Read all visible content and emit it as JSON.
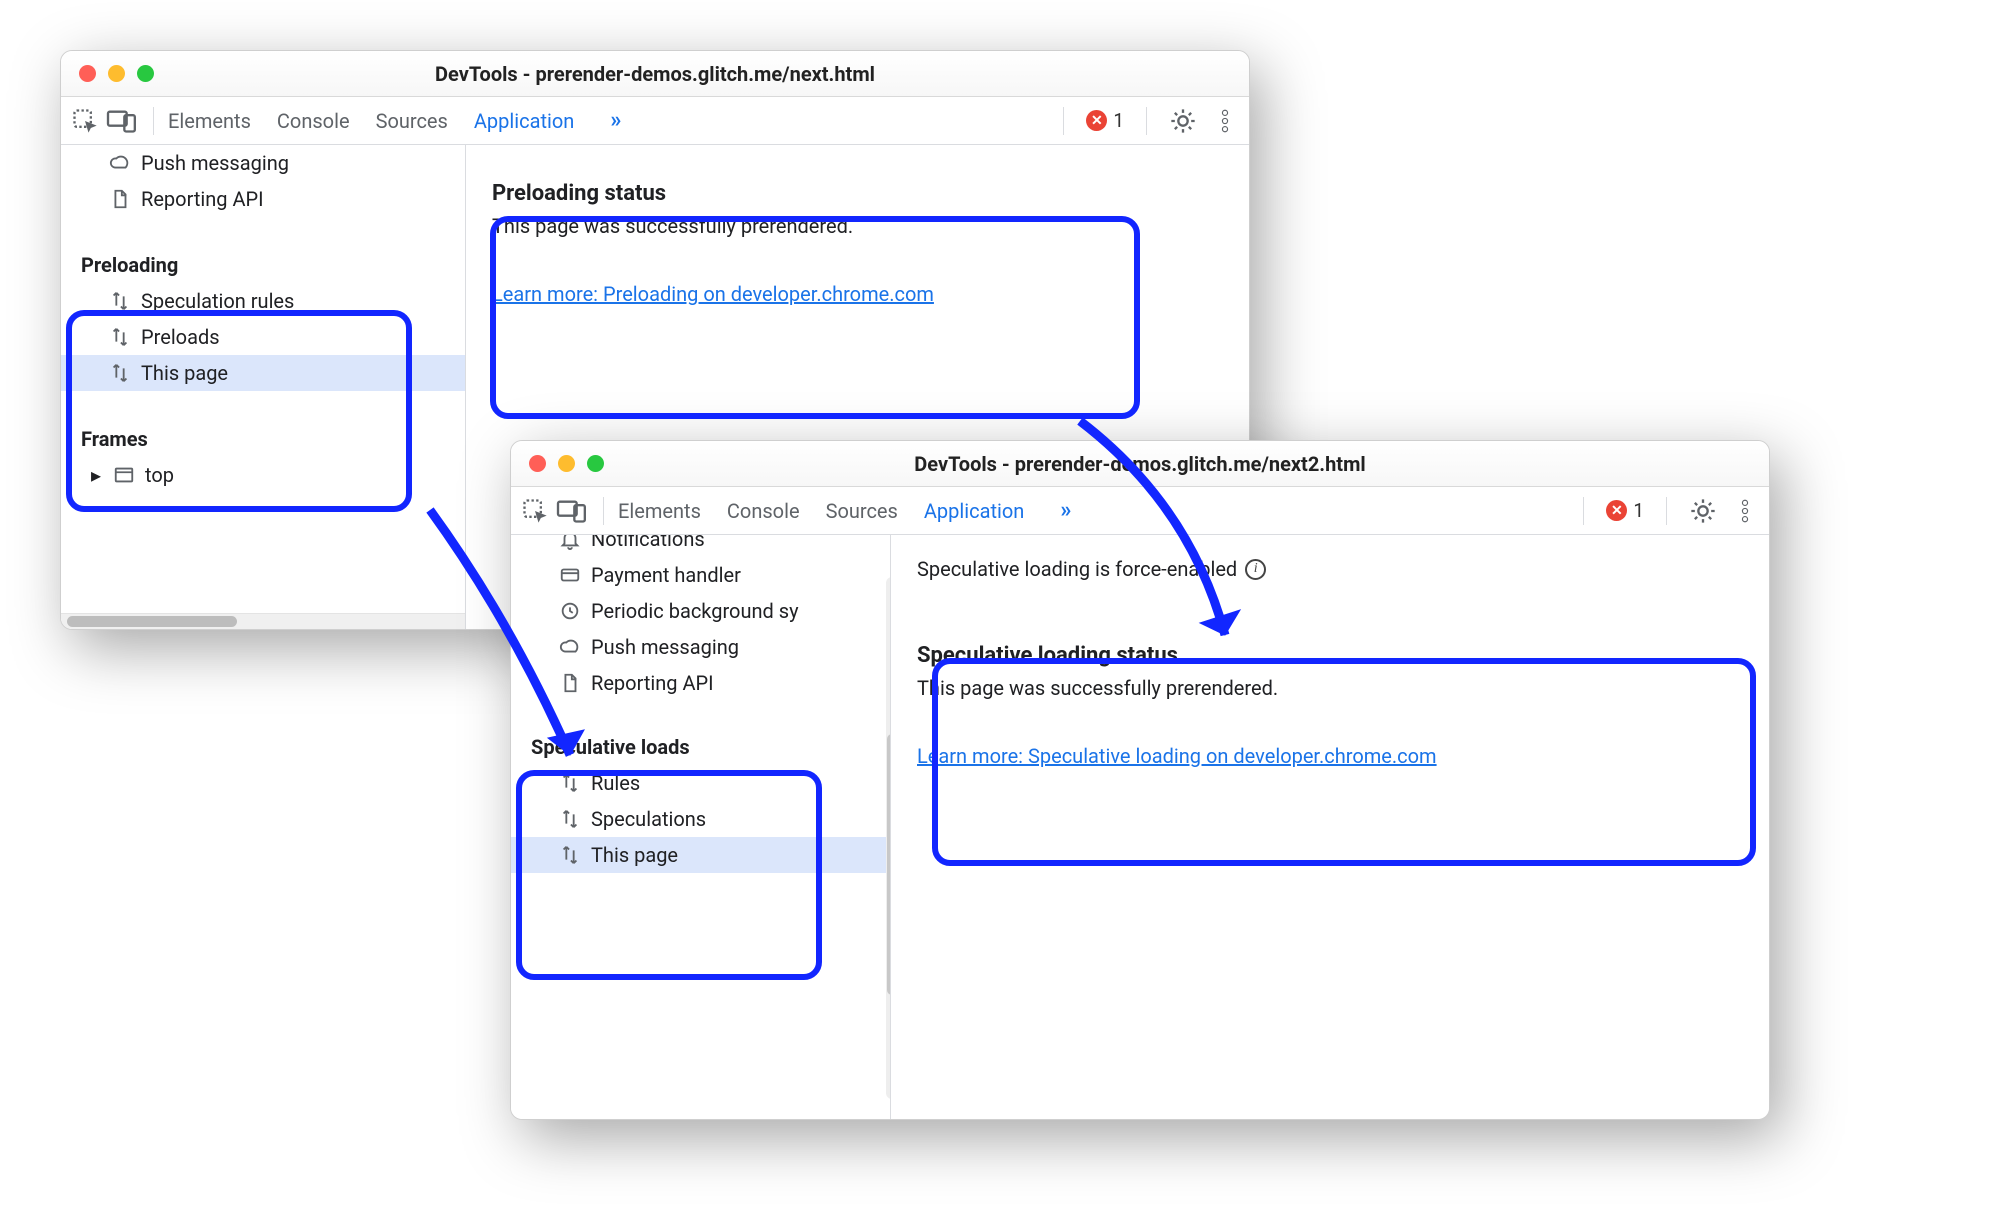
{
  "window1": {
    "title": "DevTools - prerender-demos.glitch.me/next.html",
    "toolbar": {
      "tabs": [
        "Elements",
        "Console",
        "Sources",
        "Application"
      ],
      "activeTab": "Application",
      "overflow": "»",
      "error": {
        "symbol": "✕",
        "count": "1"
      }
    },
    "sidebar": {
      "items_top": [
        {
          "name": "push-messaging",
          "icon": "cloud",
          "label": "Push messaging"
        },
        {
          "name": "reporting-api",
          "icon": "doc",
          "label": "Reporting API"
        }
      ],
      "section1": {
        "label": "Preloading",
        "items": [
          {
            "name": "speculation-rules",
            "icon": "swap",
            "label": "Speculation rules"
          },
          {
            "name": "preloads",
            "icon": "swap",
            "label": "Preloads"
          },
          {
            "name": "this-page",
            "icon": "swap",
            "label": "This page",
            "selected": true
          }
        ]
      },
      "section2": {
        "label": "Frames",
        "items": [
          {
            "name": "frames-top",
            "icon": "window",
            "label": "top",
            "expander": "▸"
          }
        ]
      }
    },
    "main": {
      "title": "Preloading status",
      "text": "This page was successfully prerendered.",
      "link": "Learn more: Preloading on developer.chrome.com"
    }
  },
  "window2": {
    "title": "DevTools - prerender-demos.glitch.me/next2.html",
    "toolbar": {
      "tabs": [
        "Elements",
        "Console",
        "Sources",
        "Application"
      ],
      "activeTab": "Application",
      "overflow": "»",
      "error": {
        "symbol": "✕",
        "count": "1"
      }
    },
    "sidebar": {
      "items_top": [
        {
          "name": "notifications",
          "icon": "bell",
          "label": "Notifications"
        },
        {
          "name": "payment-handler",
          "icon": "card",
          "label": "Payment handler"
        },
        {
          "name": "periodic-bg-sync",
          "icon": "clock",
          "label": "Periodic background sy"
        },
        {
          "name": "push-messaging",
          "icon": "cloud",
          "label": "Push messaging"
        },
        {
          "name": "reporting-api",
          "icon": "doc",
          "label": "Reporting API"
        }
      ],
      "section1": {
        "label": "Speculative loads",
        "items": [
          {
            "name": "rules",
            "icon": "swap",
            "label": "Rules"
          },
          {
            "name": "speculations",
            "icon": "swap",
            "label": "Speculations"
          },
          {
            "name": "this-page",
            "icon": "swap",
            "label": "This page",
            "selected": true
          }
        ]
      }
    },
    "main": {
      "status": "Speculative loading is force-enabled",
      "title": "Speculative loading status",
      "text": "This page was successfully prerendered.",
      "link": "Learn more: Speculative loading on developer.chrome.com"
    }
  }
}
